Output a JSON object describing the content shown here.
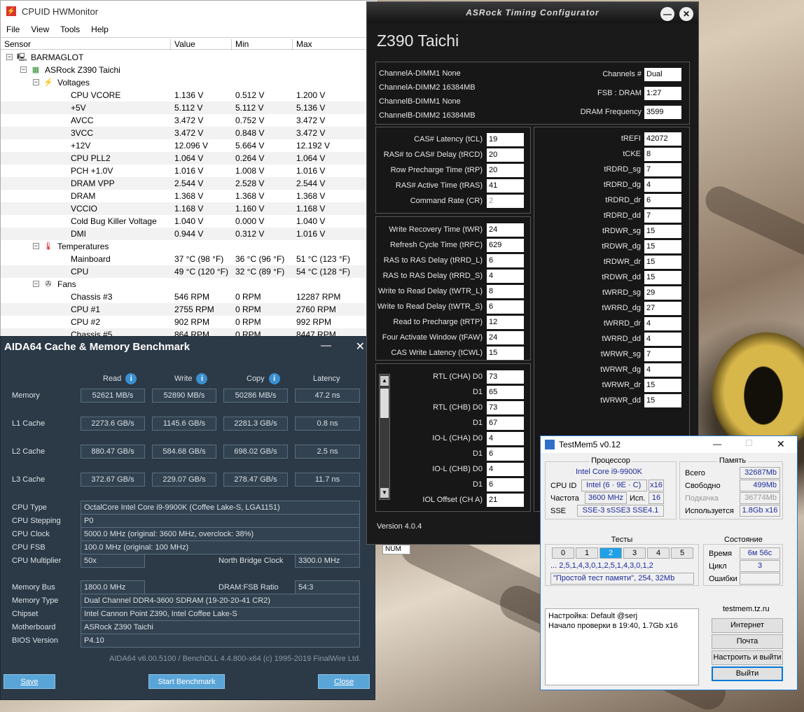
{
  "hwmonitor": {
    "title": "CPUID HWMonitor",
    "menu": [
      "File",
      "View",
      "Tools",
      "Help"
    ],
    "columns": [
      "Sensor",
      "Value",
      "Min",
      "Max"
    ],
    "computer": "BARMAGLOT",
    "board": "ASRock Z390 Taichi",
    "voltages_label": "Voltages",
    "voltages": [
      {
        "name": "CPU VCORE",
        "value": "1.136 V",
        "min": "0.512 V",
        "max": "1.200 V"
      },
      {
        "name": "+5V",
        "value": "5.112 V",
        "min": "5.112 V",
        "max": "5.136 V"
      },
      {
        "name": "AVCC",
        "value": "3.472 V",
        "min": "0.752 V",
        "max": "3.472 V"
      },
      {
        "name": "3VCC",
        "value": "3.472 V",
        "min": "0.848 V",
        "max": "3.472 V"
      },
      {
        "name": "+12V",
        "value": "12.096 V",
        "min": "5.664 V",
        "max": "12.192 V"
      },
      {
        "name": "CPU PLL2",
        "value": "1.064 V",
        "min": "0.264 V",
        "max": "1.064 V"
      },
      {
        "name": "PCH +1.0V",
        "value": "1.016 V",
        "min": "1.008 V",
        "max": "1.016 V"
      },
      {
        "name": "DRAM VPP",
        "value": "2.544 V",
        "min": "2.528 V",
        "max": "2.544 V"
      },
      {
        "name": "DRAM",
        "value": "1.368 V",
        "min": "1.368 V",
        "max": "1.368 V"
      },
      {
        "name": "VCCIO",
        "value": "1.168 V",
        "min": "1.160 V",
        "max": "1.168 V"
      },
      {
        "name": "Cold Bug Killer Voltage",
        "value": "1.040 V",
        "min": "0.000 V",
        "max": "1.040 V"
      },
      {
        "name": "DMI",
        "value": "0.944 V",
        "min": "0.312 V",
        "max": "1.016 V"
      }
    ],
    "temps_label": "Temperatures",
    "temps": [
      {
        "name": "Mainboard",
        "value": "37 °C  (98 °F)",
        "min": "36 °C  (96 °F)",
        "max": "51 °C  (123 °F)"
      },
      {
        "name": "CPU",
        "value": "49 °C  (120 °F)",
        "min": "32 °C  (89 °F)",
        "max": "54 °C  (128 °F)"
      }
    ],
    "fans_label": "Fans",
    "fans": [
      {
        "name": "Chassis #3",
        "value": "546 RPM",
        "min": "0 RPM",
        "max": "12287 RPM"
      },
      {
        "name": "CPU #1",
        "value": "2755 RPM",
        "min": "0 RPM",
        "max": "2760 RPM"
      },
      {
        "name": "CPU #2",
        "value": "902 RPM",
        "min": "0 RPM",
        "max": "992 RPM"
      },
      {
        "name": "Chassis #5",
        "value": "864 RPM",
        "min": "0 RPM",
        "max": "8447 RPM"
      }
    ]
  },
  "aida": {
    "title": "AIDA64 Cache & Memory Benchmark",
    "headers": {
      "read": "Read",
      "write": "Write",
      "copy": "Copy",
      "latency": "Latency"
    },
    "rows": [
      {
        "label": "Memory",
        "read": "52621 MB/s",
        "write": "52890 MB/s",
        "copy": "50286 MB/s",
        "latency": "47.2 ns"
      },
      {
        "label": "L1 Cache",
        "read": "2273.6 GB/s",
        "write": "1145.6 GB/s",
        "copy": "2281.3 GB/s",
        "latency": "0.8 ns"
      },
      {
        "label": "L2 Cache",
        "read": "880.47 GB/s",
        "write": "584.68 GB/s",
        "copy": "698.02 GB/s",
        "latency": "2.5 ns"
      },
      {
        "label": "L3 Cache",
        "read": "372.67 GB/s",
        "write": "229.07 GB/s",
        "copy": "278.47 GB/s",
        "latency": "11.7 ns"
      }
    ],
    "cpu_type_label": "CPU Type",
    "cpu_type": "OctalCore Intel Core i9-9900K  (Coffee Lake-S, LGA1151)",
    "cpu_stepping_label": "CPU Stepping",
    "cpu_stepping": "P0",
    "cpu_clock_label": "CPU Clock",
    "cpu_clock": "5000.0 MHz  (original: 3600 MHz, overclock: 38%)",
    "cpu_fsb_label": "CPU FSB",
    "cpu_fsb": "100.0 MHz  (original: 100 MHz)",
    "cpu_mult_label": "CPU Multiplier",
    "cpu_mult": "50x",
    "nb_clock_label": "North Bridge Clock",
    "nb_clock": "3300.0 MHz",
    "mem_bus_label": "Memory Bus",
    "mem_bus": "1800.0 MHz",
    "dram_fsb_label": "DRAM:FSB Ratio",
    "dram_fsb": "54:3",
    "mem_type_label": "Memory Type",
    "mem_type": "Dual Channel DDR4-3600 SDRAM  (19-20-20-41 CR2)",
    "chipset_label": "Chipset",
    "chipset": "Intel Cannon Point Z390, Intel Coffee Lake-S",
    "mobo_label": "Motherboard",
    "mobo": "ASRock Z390 Taichi",
    "bios_label": "BIOS Version",
    "bios": "P4.10",
    "footer": "AIDA64 v6.00.5100 / BenchDLL 4.4.800-x64  (c) 1995-2019 FinalWire Ltd.",
    "save": "Save",
    "start": "Start Benchmark",
    "close": "Close"
  },
  "asrock": {
    "title": "ASRock Timing Configurator",
    "model": "Z390 Taichi",
    "dimms": [
      "ChannelA-DIMM1  None",
      "ChannelA-DIMM2  16384MB",
      "ChannelB-DIMM1  None",
      "ChannelB-DIMM2  16384MB"
    ],
    "channels_label": "Channels #",
    "channels": "Dual",
    "fsb_label": "FSB : DRAM",
    "fsb": "1:27",
    "freq_label": "DRAM Frequency",
    "freq": "3599",
    "primary": [
      {
        "label": "CAS# Latency (tCL)",
        "value": "19"
      },
      {
        "label": "RAS# to CAS# Delay (tRCD)",
        "value": "20"
      },
      {
        "label": "Row Precharge Time (tRP)",
        "value": "20"
      },
      {
        "label": "RAS# Active Time (tRAS)",
        "value": "41"
      },
      {
        "label": "Command Rate (CR)",
        "value": "2"
      }
    ],
    "secondary": [
      {
        "label": "Write Recovery Time (tWR)",
        "value": "24"
      },
      {
        "label": "Refresh Cycle Time (tRFC)",
        "value": "629"
      },
      {
        "label": "RAS to RAS Delay (tRRD_L)",
        "value": "6"
      },
      {
        "label": "RAS to RAS Delay (tRRD_S)",
        "value": "4"
      },
      {
        "label": "Write to Read Delay (tWTR_L)",
        "value": "8"
      },
      {
        "label": "Write to Read Delay (tWTR_S)",
        "value": "6"
      },
      {
        "label": "Read to Precharge (tRTP)",
        "value": "12"
      },
      {
        "label": "Four Activate Window (tFAW)",
        "value": "24"
      },
      {
        "label": "CAS Write Latency (tCWL)",
        "value": "15"
      }
    ],
    "rtl": [
      {
        "label": "RTL (CHA) D0",
        "value": "73"
      },
      {
        "label": "D1",
        "value": "65"
      },
      {
        "label": "RTL (CHB) D0",
        "value": "73"
      },
      {
        "label": "D1",
        "value": "67"
      },
      {
        "label": "IO-L (CHA) D0",
        "value": "4"
      },
      {
        "label": "D1",
        "value": "6"
      },
      {
        "label": "IO-L (CHB) D0",
        "value": "4"
      },
      {
        "label": "D1",
        "value": "6"
      },
      {
        "label": "IOL Offset (CH A)",
        "value": "21"
      }
    ],
    "tertiary": [
      {
        "label": "tREFI",
        "value": "42072"
      },
      {
        "label": "tCKE",
        "value": "8"
      },
      {
        "label": "tRDRD_sg",
        "value": "7"
      },
      {
        "label": "tRDRD_dg",
        "value": "4"
      },
      {
        "label": "tRDRD_dr",
        "value": "6"
      },
      {
        "label": "tRDRD_dd",
        "value": "7"
      },
      {
        "label": "tRDWR_sg",
        "value": "15"
      },
      {
        "label": "tRDWR_dg",
        "value": "15"
      },
      {
        "label": "tRDWR_dr",
        "value": "15"
      },
      {
        "label": "tRDWR_dd",
        "value": "15"
      },
      {
        "label": "tWRRD_sg",
        "value": "29"
      },
      {
        "label": "tWRRD_dg",
        "value": "27"
      },
      {
        "label": "tWRRD_dr",
        "value": "4"
      },
      {
        "label": "tWRRD_dd",
        "value": "4"
      },
      {
        "label": "tWRWR_sg",
        "value": "7"
      },
      {
        "label": "tWRWR_dg",
        "value": "4"
      },
      {
        "label": "tWRWR_dr",
        "value": "15"
      },
      {
        "label": "tWRWR_dd",
        "value": "15"
      }
    ],
    "version": "Version 4.0.4",
    "num_indicator": "NUM"
  },
  "testmem": {
    "title": "TestMem5 v0.12",
    "cpu_group": "Процессор",
    "cpu_name": "Intel Core i9-9900K",
    "cpu_id_label": "CPU ID",
    "cpu_id": "Intel  (6 · 9E · C)",
    "cpu_id_threads": "x16",
    "freq_label": "Частота",
    "freq": "3600 MHz",
    "used_label": "Исп.",
    "used": "16",
    "sse_label": "SSE",
    "sse": "SSE-3 sSSE3 SSE4.1",
    "mem_group": "Память",
    "total_label": "Всего",
    "total": "32687Mb",
    "free_label": "Свободно",
    "free": "499Mb",
    "swap_label": "Подкачка",
    "swap": "36774Mb",
    "inuse_label": "Используется",
    "inuse": "1.8Gb x16",
    "tests_group": "Тесты",
    "tabs": [
      "0",
      "1",
      "2",
      "3",
      "4",
      "5"
    ],
    "sequence": "... 2,5,1,4,3,0,1,2,5,1,4,3,0,1,2",
    "test_desc": "\"Простой тест памяти\", 254, 32Mb",
    "state_group": "Состояние",
    "time_label": "Время",
    "time": "6м 56с",
    "cycle_label": "Цикл",
    "cycle": "3",
    "errors_label": "Ошибки",
    "errors": "",
    "log": [
      "Настройка: Default @serj",
      "Начало проверки в 19:40, 1.7Gb x16"
    ],
    "site": "testmem.tz.ru",
    "btn_internet": "Интернет",
    "btn_mail": "Почта",
    "btn_setup": "Настроить и выйти",
    "btn_exit": "Выйти"
  }
}
